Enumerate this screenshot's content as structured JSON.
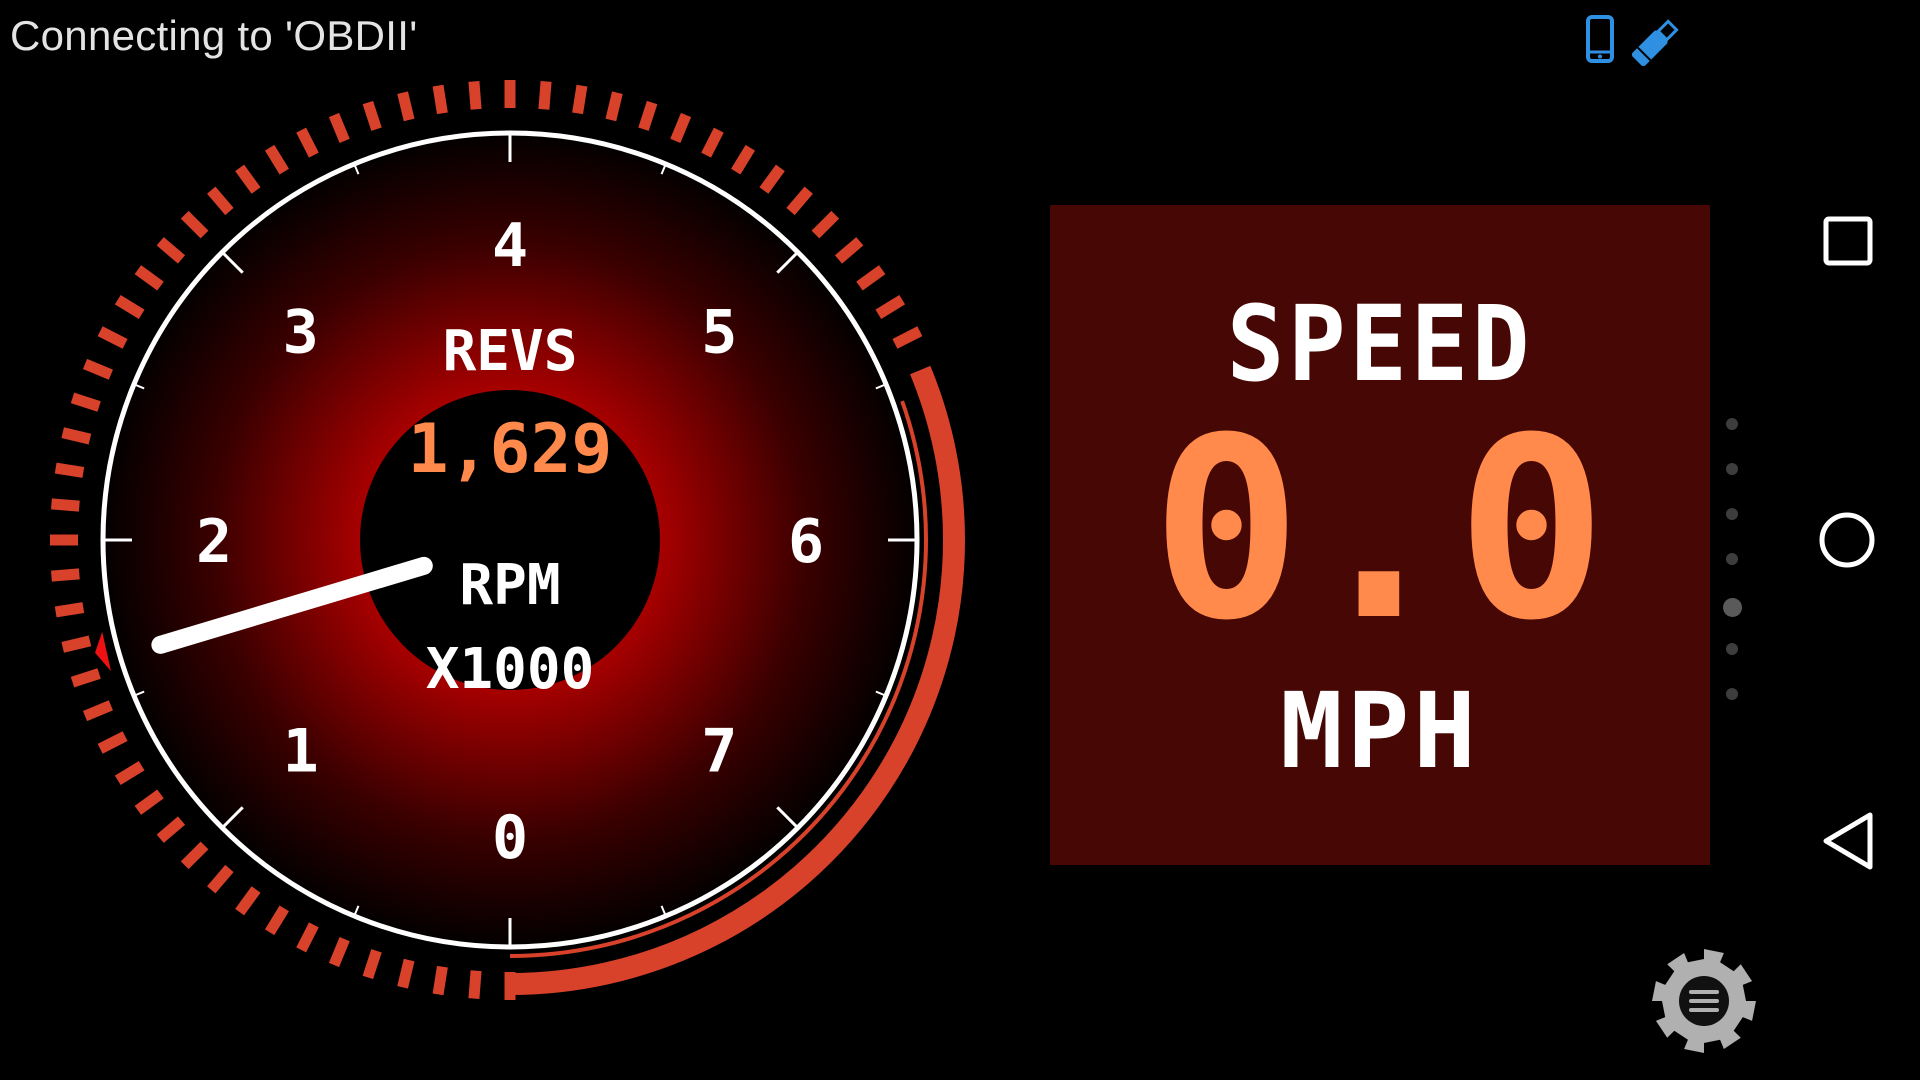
{
  "status_bar": {
    "connection_text": "Connecting to 'OBDII'",
    "icons": [
      "phone-icon",
      "obd-dongle-icon"
    ],
    "icon_color": "#2f8fe0"
  },
  "rev_gauge": {
    "title": "REVS",
    "value": "1,629",
    "rpm_value": 1629,
    "unit": "RPM",
    "multiplier": "X1000",
    "scale_labels": [
      "0",
      "1",
      "2",
      "3",
      "4",
      "5",
      "6",
      "7"
    ],
    "scale_min": 0,
    "scale_max": 8,
    "redline_start": 5.5,
    "colors": {
      "accent": "#d8412a",
      "value": "#ff8a4c",
      "text": "#ffffff",
      "glow": "#b00000"
    }
  },
  "speed_panel": {
    "label": "SPEED",
    "value": "0.0",
    "unit": "MPH",
    "background": "#470805",
    "value_color": "#ff8a4c"
  },
  "page_indicator": {
    "count": 7,
    "active_index": 4
  },
  "nav_bar": {
    "buttons": [
      "recent-apps",
      "home",
      "back"
    ]
  },
  "settings": {
    "icon": "gear-menu-icon",
    "color": "#b0b0b0"
  }
}
